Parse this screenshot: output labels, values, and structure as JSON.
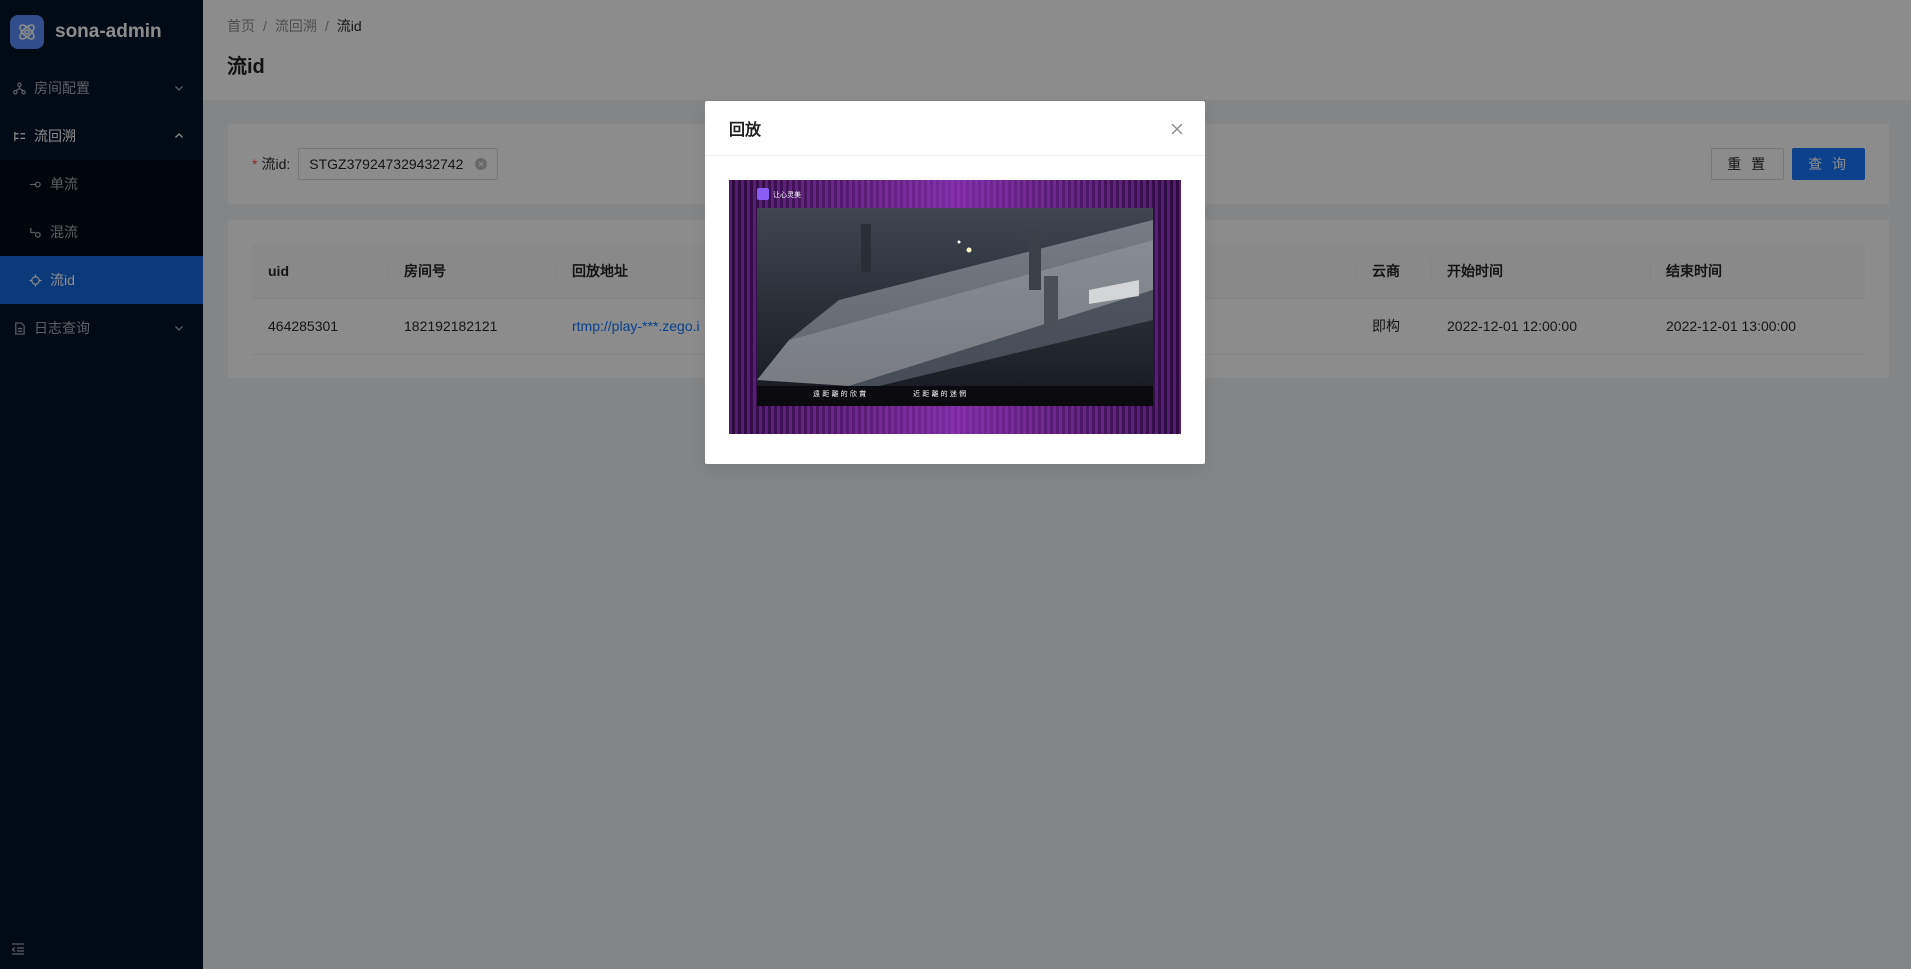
{
  "app": {
    "title": "sona-admin"
  },
  "sidebar": {
    "items": [
      {
        "label": "房间配置",
        "icon": "apartment-icon",
        "expanded": false
      },
      {
        "label": "流回溯",
        "icon": "tree-icon",
        "expanded": true,
        "children": [
          {
            "label": "单流",
            "icon": "node-icon"
          },
          {
            "label": "混流",
            "icon": "merge-icon"
          },
          {
            "label": "流id",
            "icon": "aim-icon",
            "selected": true
          }
        ]
      },
      {
        "label": "日志查询",
        "icon": "file-icon",
        "expanded": false
      }
    ],
    "collapse_icon": "menu-fold-icon"
  },
  "header": {
    "breadcrumb": [
      "首页",
      "流回溯",
      "流id"
    ],
    "title": "流id"
  },
  "search": {
    "label": "流id",
    "value": "STGZ379247329432742",
    "reset_label": "重 置",
    "query_label": "查 询"
  },
  "table": {
    "columns": [
      "uid",
      "房间号",
      "回放地址",
      "云商",
      "开始时间",
      "结束时间"
    ],
    "rows": [
      {
        "uid": "464285301",
        "room": "182192182121",
        "url": "rtmp://play-***.zego.i",
        "cloud": "即构",
        "start": "2022-12-01 12:00:00",
        "end": "2022-12-01 13:00:00"
      }
    ]
  },
  "modal": {
    "title": "回放",
    "video": {
      "logo_text": "让心灵美",
      "subtitle_left": "遠 距 離 的 欣 賞",
      "subtitle_right": "近 距 離 的 迷 惘"
    }
  },
  "colors": {
    "sider": "#001529",
    "selected": "#1668dc",
    "primary": "#1677ff",
    "video_bg": "#3a0e52"
  }
}
